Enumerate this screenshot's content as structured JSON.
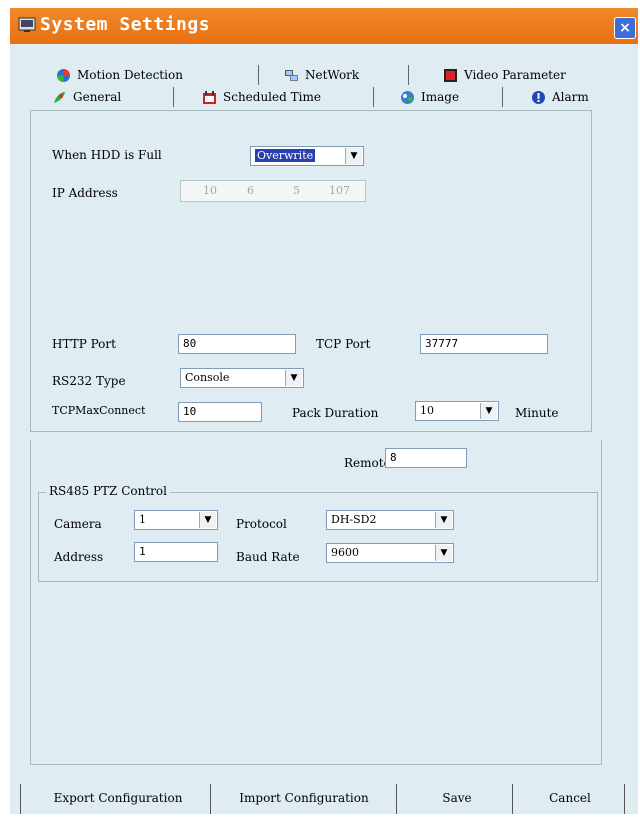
{
  "window": {
    "title": "System Settings",
    "close_glyph": "×"
  },
  "tabs_row1": [
    {
      "label": "Motion Detection",
      "icon": "motion-detection-icon"
    },
    {
      "label": "NetWork",
      "icon": "network-icon"
    },
    {
      "label": "Video Parameter",
      "icon": "video-parameter-icon"
    }
  ],
  "tabs_row2": [
    {
      "label": "General",
      "icon": "general-icon",
      "active": true
    },
    {
      "label": "Scheduled Time",
      "icon": "scheduled-time-icon"
    },
    {
      "label": "Image",
      "icon": "image-icon"
    },
    {
      "label": "Alarm",
      "icon": "alarm-icon"
    }
  ],
  "general": {
    "hdd_full_label": "When HDD is Full",
    "hdd_full_value": "Overwrite",
    "ip_label": "IP Address",
    "ip_octets": [
      "10",
      "6",
      "5",
      "107"
    ],
    "http_port_label": "HTTP Port",
    "http_port_value": "80",
    "tcp_port_label": "TCP Port",
    "tcp_port_value": "37777",
    "rs232_label": "RS232 Type",
    "rs232_value": "Console",
    "tcp_max_label": "TCPMaxConnect",
    "tcp_max_value": "10",
    "pack_duration_label": "Pack Duration",
    "pack_duration_value": "10",
    "pack_duration_unit": "Minute",
    "remote_label": "Remote",
    "remote_value": "8"
  },
  "rs485": {
    "group_title": "RS485 PTZ Control",
    "camera_label": "Camera",
    "camera_value": "1",
    "protocol_label": "Protocol",
    "protocol_value": "DH-SD2",
    "address_label": "Address",
    "address_value": "1",
    "baud_label": "Baud Rate",
    "baud_value": "9600"
  },
  "buttons": {
    "export": "Export Configuration",
    "import": "Import Configuration",
    "save": "Save",
    "cancel": "Cancel"
  },
  "colors": {
    "titlebar": "#e87a1c",
    "dialog_bg": "#dfecf1",
    "selection": "#2a3fb0"
  }
}
